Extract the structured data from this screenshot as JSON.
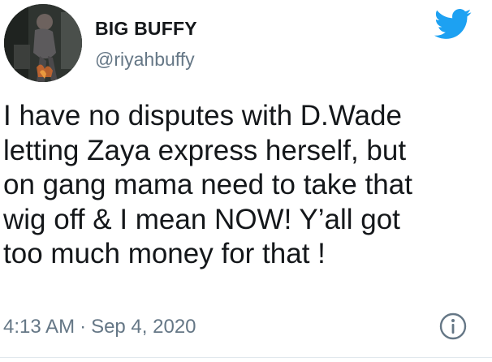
{
  "tweet": {
    "display_name": "BIG BUFFY",
    "handle": "@riyahbuffy",
    "text": "I have no disputes with D.Wade\nletting Zaya express herself, but\non gang mama need to take that\nwig off & I mean NOW! Y’all got\ntoo much money for that !",
    "time": "4:13 AM",
    "separator": "·",
    "date": "Sep 4, 2020"
  },
  "icons": {
    "logo": "twitter-bird-icon",
    "info": "info-icon"
  },
  "colors": {
    "text": "#14171a",
    "secondary": "#657786",
    "brand": "#1da1f2"
  }
}
